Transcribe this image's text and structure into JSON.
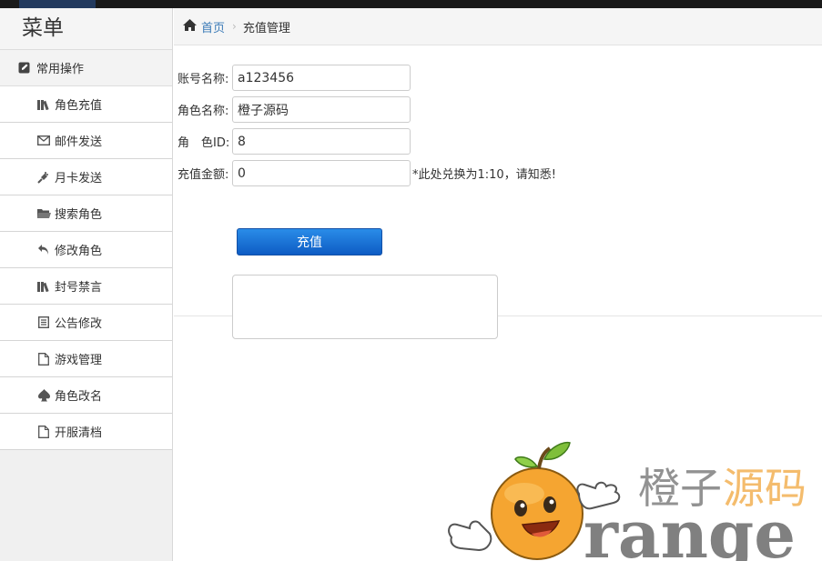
{
  "sidebar": {
    "title": "菜单",
    "section": {
      "label": "常用操作",
      "icon": "edit-icon"
    },
    "items": [
      {
        "label": "角色充值",
        "icon": "books-icon"
      },
      {
        "label": "邮件发送",
        "icon": "envelope-icon"
      },
      {
        "label": "月卡发送",
        "icon": "plug-icon"
      },
      {
        "label": "搜索角色",
        "icon": "folder-icon"
      },
      {
        "label": "修改角色",
        "icon": "undo-icon"
      },
      {
        "label": "封号禁言",
        "icon": "books-icon"
      },
      {
        "label": "公告修改",
        "icon": "list-icon"
      },
      {
        "label": "游戏管理",
        "icon": "file-icon"
      },
      {
        "label": "角色改名",
        "icon": "spade-icon"
      },
      {
        "label": "开服清档",
        "icon": "file-icon"
      }
    ]
  },
  "breadcrumb": {
    "home_label": "首页",
    "current": "充值管理"
  },
  "form": {
    "account": {
      "label": "账号名称:",
      "value": "a123456"
    },
    "role_name": {
      "label": "角色名称:",
      "value": "橙子源码"
    },
    "role_id": {
      "label": "角　色ID:",
      "value": "8"
    },
    "amount": {
      "label": "充值金额:",
      "value": "0"
    },
    "hint": "*此处兑换为1:10，请知悉!",
    "submit_label": "充值",
    "result_value": ""
  },
  "watermark": {
    "cn_text_1": "橙子",
    "cn_text_2": "源码",
    "en_text": "range"
  },
  "colors": {
    "link": "#3a7ab7",
    "button": "#0e5cc4",
    "watermark_orange": "#f0a030",
    "watermark_gray": "#808080"
  }
}
